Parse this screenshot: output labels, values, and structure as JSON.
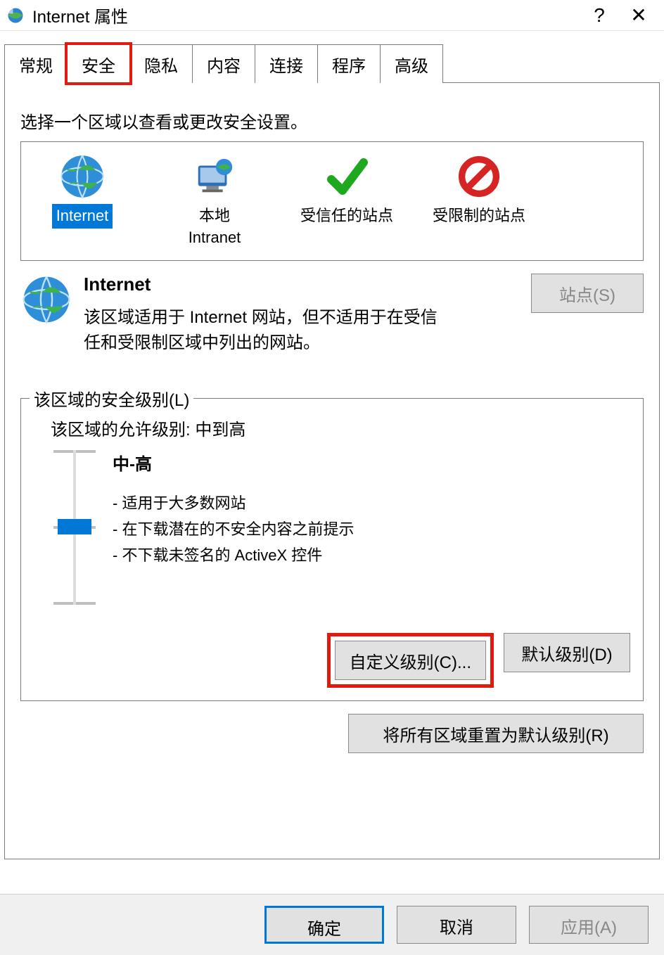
{
  "titlebar": {
    "title": "Internet 属性"
  },
  "tabs": {
    "general": "常规",
    "security": "安全",
    "privacy": "隐私",
    "content": "内容",
    "connections": "连接",
    "programs": "程序",
    "advanced": "高级",
    "active": "security"
  },
  "security": {
    "instruction": "选择一个区域以查看或更改安全设置。",
    "zones": {
      "internet": "Internet",
      "intranet": "本地\nIntranet",
      "trusted": "受信任的站点",
      "restricted": "受限制的站点",
      "selected": "internet"
    },
    "zone_info": {
      "heading": "Internet",
      "description": "该区域适用于 Internet 网站，但不适用于在受信任和受限制区域中列出的网站。",
      "sites_button": "站点(S)"
    },
    "level_fieldset": {
      "legend": "该区域的安全级别(L)",
      "allowed_label": "该区域的允许级别: 中到高",
      "level_title": "中-高",
      "bullet1": "- 适用于大多数网站",
      "bullet2": "- 在下载潜在的不安全内容之前提示",
      "bullet3": "- 不下载未签名的 ActiveX 控件",
      "custom_button": "自定义级别(C)...",
      "default_button": "默认级别(D)",
      "reset_button": "将所有区域重置为默认级别(R)"
    }
  },
  "dialog_buttons": {
    "ok": "确定",
    "cancel": "取消",
    "apply": "应用(A)"
  }
}
